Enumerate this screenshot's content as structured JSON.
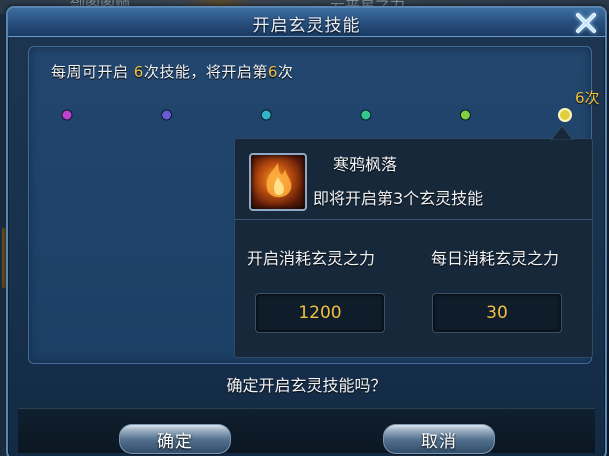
{
  "background": {
    "partial_text_left": "剑阁阁顾",
    "partial_text_right": "云夹星之力"
  },
  "dialog": {
    "title": "开启玄灵技能",
    "close_icon": "close-x-icon"
  },
  "weekly": {
    "prefix": "每周可开启 ",
    "times_per_week": "6",
    "middle": "次技能，将开启第",
    "next_index": "6",
    "suffix": "次"
  },
  "progress": {
    "total_nodes": 6,
    "current_node": 6,
    "max_label": "6次",
    "node_colors": [
      "#c040d0",
      "#6a5ad8",
      "#30b8c8",
      "#30c890",
      "#80d040",
      "#e0d040"
    ]
  },
  "skill": {
    "name": "寒鸦枫落",
    "icon": "skill-flame-icon",
    "description": "即将开启第3个玄灵技能"
  },
  "costs": {
    "open_label": "开启消耗玄灵之力",
    "open_value": "1200",
    "daily_label": "每日消耗玄灵之力",
    "daily_value": "30"
  },
  "confirm": {
    "question": "确定开启玄灵技能吗？",
    "ok_label": "确定",
    "cancel_label": "取消"
  },
  "colors": {
    "highlight": "#f0c040",
    "panel": "#1e3a5c"
  }
}
